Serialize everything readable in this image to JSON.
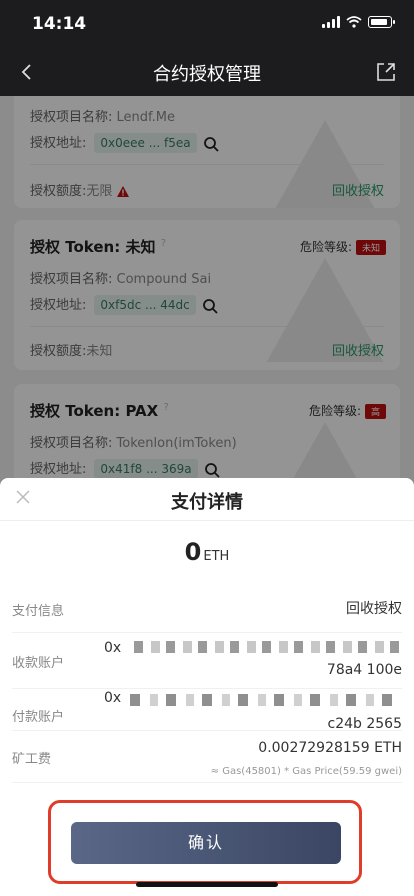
{
  "status_bar": {
    "time": "14:14"
  },
  "header": {
    "title": "合约授权管理"
  },
  "cards": [
    {
      "project_label": "授权项目名称:",
      "project": "Lendf.Me",
      "address_label": "授权地址:",
      "address": "0x0eee ... f5ea",
      "quota_label": "授权额度:",
      "quota": "无限",
      "revoke": "回收授权"
    },
    {
      "title_label": "授权 Token:",
      "token": "未知",
      "risk_label": "危险等级:",
      "risk": "未知",
      "project_label": "授权项目名称:",
      "project": "Compound Sai",
      "address_label": "授权地址:",
      "address": "0xf5dc ... 44dc",
      "quota_label": "授权额度:",
      "quota": "未知",
      "revoke": "回收授权"
    },
    {
      "title_label": "授权 Token:",
      "token": "PAX",
      "risk_label": "危险等级:",
      "risk": "高",
      "project_label": "授权项目名称:",
      "project": "Tokenlon(imToken)",
      "address_label": "授权地址:",
      "address": "0x41f8 ... 369a"
    }
  ],
  "sheet": {
    "title": "支付详情",
    "amount": "0",
    "unit": "ETH",
    "payment_info_label": "支付信息",
    "payment_info": "回收授权",
    "receiver_label": "收款账户",
    "receiver_prefix": "0x",
    "receiver_suffix": "78a4 100e",
    "payer_label": "付款账户",
    "payer_prefix": "0x",
    "payer_suffix": "c24b 2565",
    "fee_label": "矿工费",
    "fee": "0.00272928159 ETH",
    "fee_detail": "≈ Gas(45801) * Gas Price(59.59 gwei)",
    "confirm": "确认"
  },
  "colors": {
    "accent_green": "#2a9a63",
    "danger": "#c01010",
    "highlight_border": "#e03c2a",
    "button": "#4a5675"
  }
}
